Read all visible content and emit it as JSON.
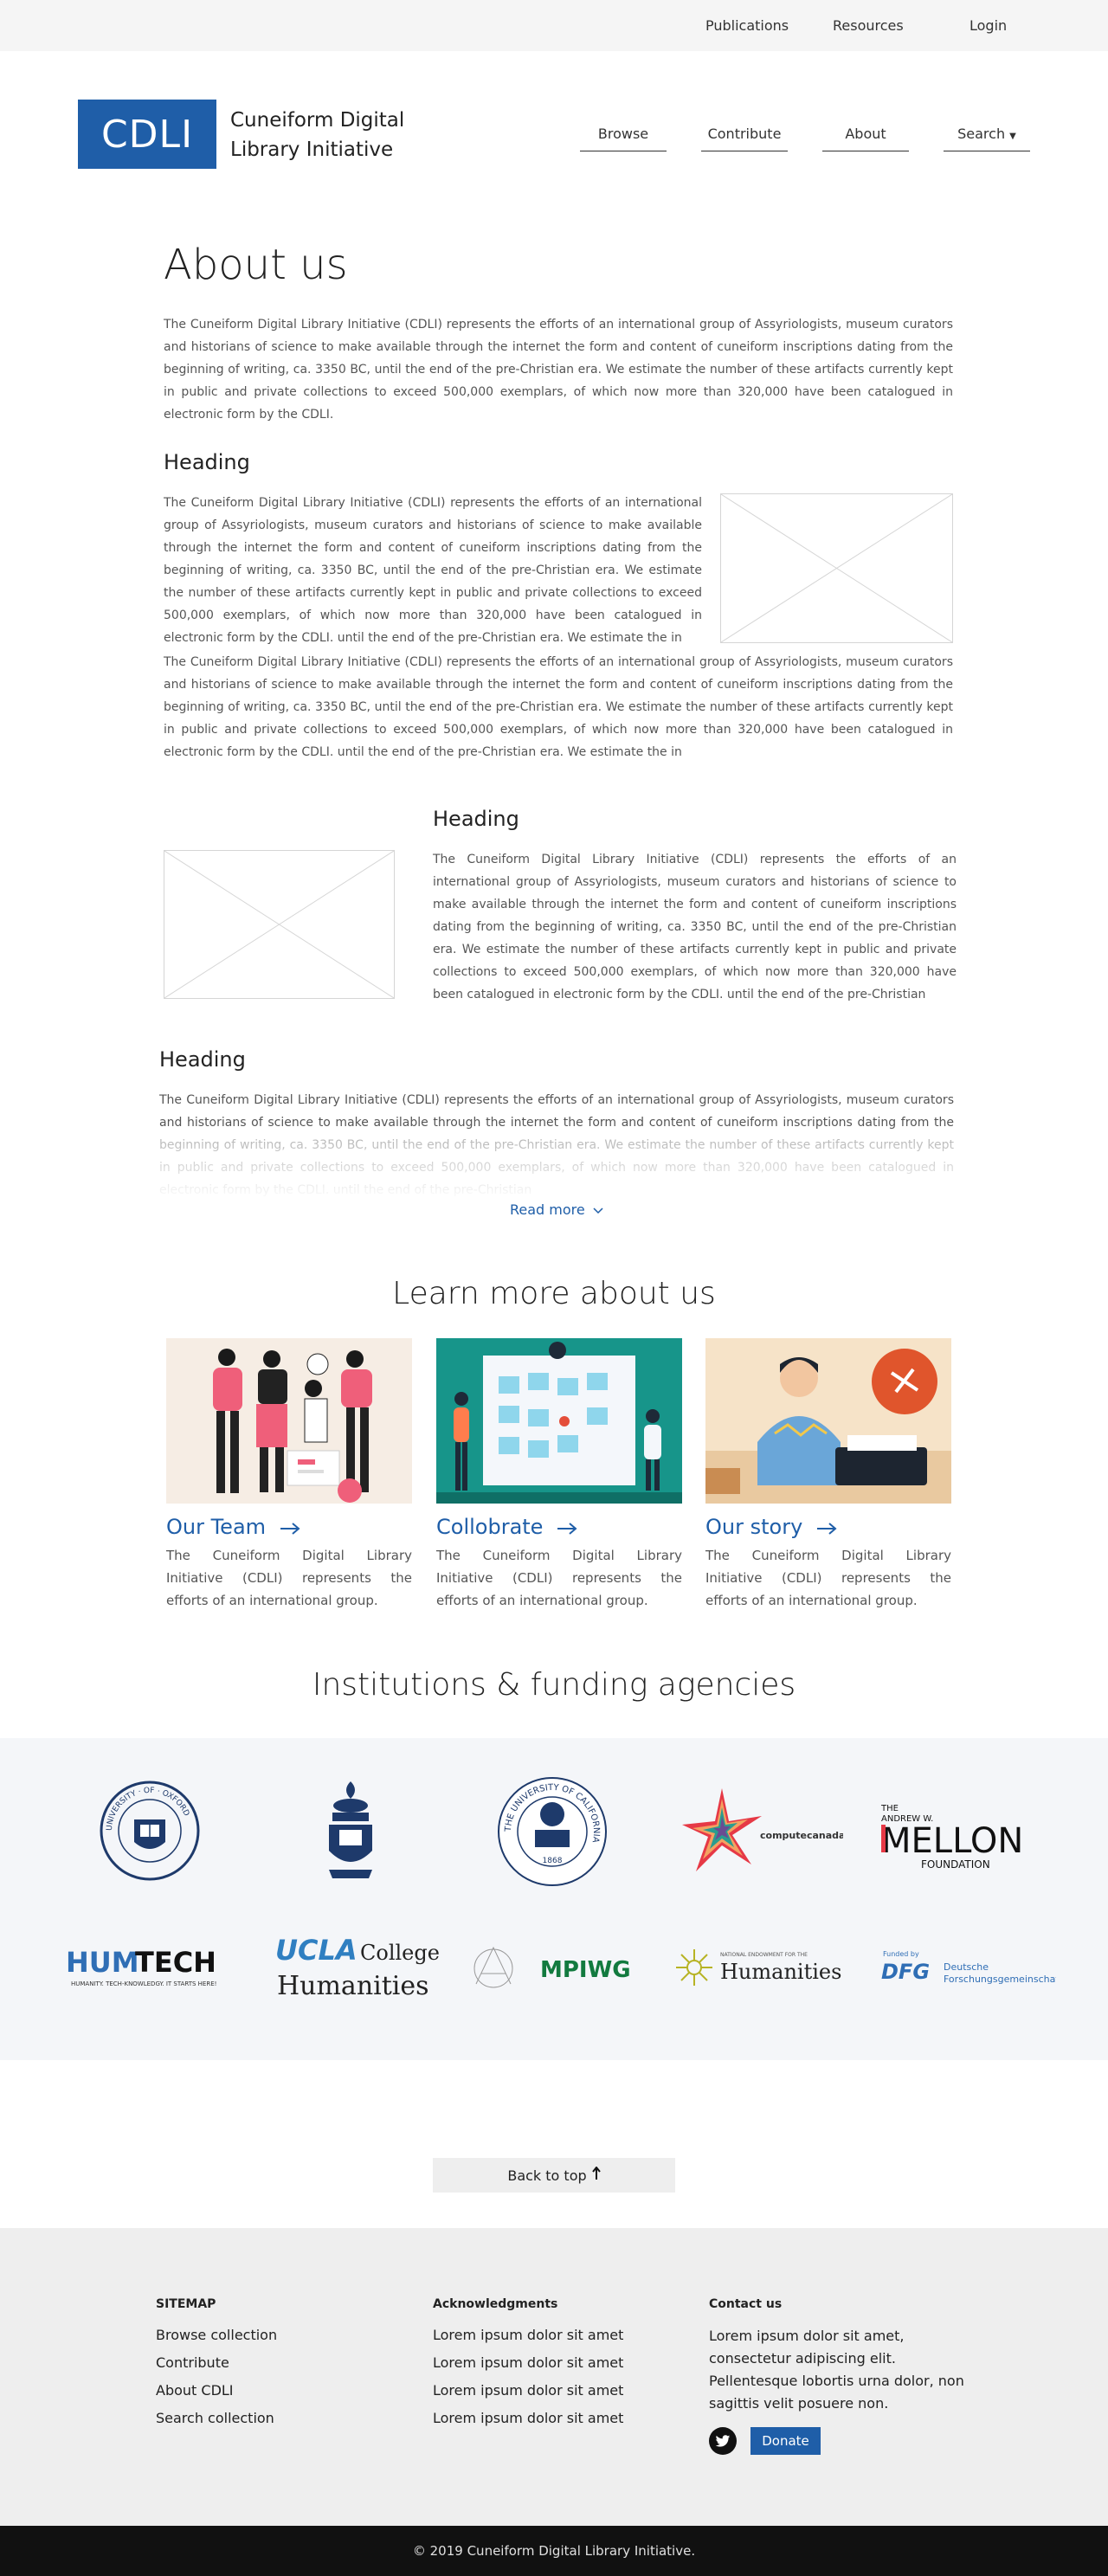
{
  "topnav": {
    "publications": "Publications",
    "resources": "Resources",
    "login": "Login"
  },
  "header": {
    "logo": "CDLI",
    "site_name": "Cuneiform Digital Library Initiative",
    "nav": {
      "browse": "Browse",
      "contribute": "Contribute",
      "about": "About",
      "search": "Search"
    }
  },
  "page": {
    "title": "About us",
    "intro": "The Cuneiform Digital Library Initiative (CDLI) represents the efforts of an international group of Assyriologists, museum curators and historians of science to make available through the internet the form and content of cuneiform inscriptions dating from the beginning of writing, ca. 3350 BC, until the end of the pre-Christian era. We estimate the number of these artifacts currently kept in public and private collections to exceed 500,000 exemplars, of which now more than 320,000 have been catalogued in electronic form by the CDLI.",
    "section1": {
      "heading": "Heading",
      "text_beside_image": "The Cuneiform Digital Library Initiative (CDLI) represents the efforts of an international group of Assyriologists, museum curators and historians of science to make available through the internet the form and content of cuneiform inscriptions dating from the beginning of writing, ca. 3350 BC, until the end of the pre-Christian era. We estimate the number of these artifacts currently kept in public and private collections to exceed 500,000 exemplars, of which now more than 320,000 have been catalogued in electronic form by the CDLI.   until the end of the pre-Christian era. We estimate the in",
      "text_full_width": "The Cuneiform Digital Library Initiative (CDLI) represents the efforts of an international group of Assyriologists, museum curators and historians of science to make available through the internet the form and content of cuneiform inscriptions dating from the beginning of writing, ca. 3350 BC, until the end of the pre-Christian era. We estimate the number of these artifacts currently kept in public and private collections to exceed 500,000 exemplars, of which now more than 320,000 have been catalogued in electronic form by the CDLI.   until the end of the pre-Christian era. We estimate the in"
    },
    "section2": {
      "heading": "Heading",
      "text": "The Cuneiform Digital Library Initiative (CDLI) represents the efforts of an international group of Assyriologists, museum curators and historians of science to make available through the internet the form and content of cuneiform inscriptions dating from the beginning of writing, ca. 3350 BC, until the end of the pre-Christian era. We estimate the number of these artifacts currently kept in public and private collections to exceed 500,000 exemplars, of which now more than 320,000 have been catalogued in electronic form by the CDLI.   until the end of the pre-Christian"
    },
    "section3": {
      "heading": "Heading",
      "text": "The Cuneiform Digital Library Initiative (CDLI) represents the efforts of an international group of Assyriologists, museum curators and historians of science to make available through the internet the form and content of cuneiform inscriptions dating from the beginning of writing, ca. 3350 BC, until the end of the pre-Christian era. We estimate the number of these artifacts currently kept in public and private collections to exceed 500,000 exemplars, of which now more than 320,000 have been catalogued in electronic form by the CDLI.   until the end of the pre-Christian",
      "read_more": "Read more"
    }
  },
  "learn_more": {
    "title": "Learn more about us",
    "cards": [
      {
        "title": "Our Team",
        "text": "The Cuneiform Digital Library Initiative (CDLI) represents the efforts of an international group."
      },
      {
        "title": "Collobrate",
        "text": "The Cuneiform Digital Library Initiative (CDLI) represents the efforts of an international group."
      },
      {
        "title": "Our story",
        "text": "The Cuneiform Digital Library Initiative (CDLI) represents the efforts of an international group."
      }
    ]
  },
  "funding": {
    "title": "Institutions & funding agencies",
    "logos": {
      "oxford_ring": "UNIVERSITY · OF · OXFORD",
      "ucal_ring": "THE UNIVERSITY OF CALIFORNIA",
      "ucal_year": "1868",
      "compute_canada": "computecanada",
      "mellon_the": "THE",
      "mellon_andrew": "ANDREW W.",
      "mellon_name": "MELLON",
      "mellon_foundation": "FOUNDATION",
      "humtech_hum": "HUM",
      "humtech_tech": "TECH",
      "humtech_tagline": "HUMANITY. TECH-KNOWLEDGY. IT STARTS HERE!",
      "ucla": "UCLA",
      "ucla_college": "College",
      "ucla_humanities": "Humanities",
      "mpiwg": "MPIWG",
      "neh_small": "NATIONAL ENDOWMENT FOR THE",
      "neh_large": "Humanities",
      "dfg_funded": "Funded by",
      "dfg": "DFG",
      "dfg_line1": "Deutsche",
      "dfg_line2": "Forschungsgemeinschaft"
    }
  },
  "back_to_top": "Back to top",
  "footer": {
    "sitemap": {
      "heading": "SITEMAP",
      "links": [
        "Browse collection",
        "Contribute",
        "About CDLI",
        "Search collection"
      ]
    },
    "acknowledgments": {
      "heading": "Acknowledgments",
      "links": [
        "Lorem ipsum dolor sit amet",
        "Lorem ipsum dolor sit amet",
        "Lorem ipsum dolor sit amet",
        "Lorem ipsum dolor sit amet"
      ]
    },
    "contact": {
      "heading": "Contact us",
      "text": "Lorem ipsum dolor sit amet, consectetur adipiscing elit. Pellentesque lobortis urna dolor, non sagittis velit posuere non.",
      "donate": "Donate"
    },
    "copyright": "© 2019 Cuneiform Digital Library Initiative."
  },
  "colors": {
    "brand": "#1f5ea8",
    "footer_bg": "#eeeeee",
    "funding_bg": "#f4f6f9",
    "bottom_bar": "#111111"
  },
  "icons": [
    "chevron-down-icon",
    "arrow-right-icon",
    "arrow-up-icon",
    "twitter-icon",
    "image-placeholder-icon"
  ]
}
